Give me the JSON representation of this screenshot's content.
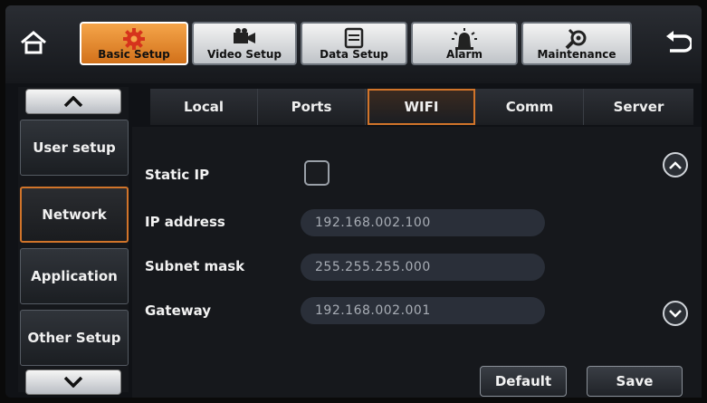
{
  "top_tabs": [
    {
      "label": "Basic Setup",
      "icon": "gear-icon",
      "active": true
    },
    {
      "label": "Video Setup",
      "icon": "camera-icon",
      "active": false
    },
    {
      "label": "Data Setup",
      "icon": "disk-icon",
      "active": false
    },
    {
      "label": "Alarm",
      "icon": "alarm-light-icon",
      "active": false
    },
    {
      "label": "Maintenance",
      "icon": "tools-icon",
      "active": false
    }
  ],
  "side_menu": {
    "items": [
      {
        "label": "User setup"
      },
      {
        "label": "Network"
      },
      {
        "label": "Application"
      },
      {
        "label": "Other Setup"
      }
    ]
  },
  "sub_tabs": [
    {
      "label": "Local"
    },
    {
      "label": "Ports"
    },
    {
      "label": "WIFI"
    },
    {
      "label": "Comm"
    },
    {
      "label": "Server"
    }
  ],
  "form": {
    "static_ip_label": "Static IP",
    "static_ip_checked": false,
    "ip_address_label": "IP address",
    "ip_address_value": "192.168.002.100",
    "subnet_mask_label": "Subnet mask",
    "subnet_mask_value": "255.255.255.000",
    "gateway_label": "Gateway",
    "gateway_value": "192.168.002.001"
  },
  "buttons": {
    "default_label": "Default",
    "save_label": "Save"
  },
  "colors": {
    "accent": "#d1742a",
    "active_tab": "#f5a54a"
  }
}
